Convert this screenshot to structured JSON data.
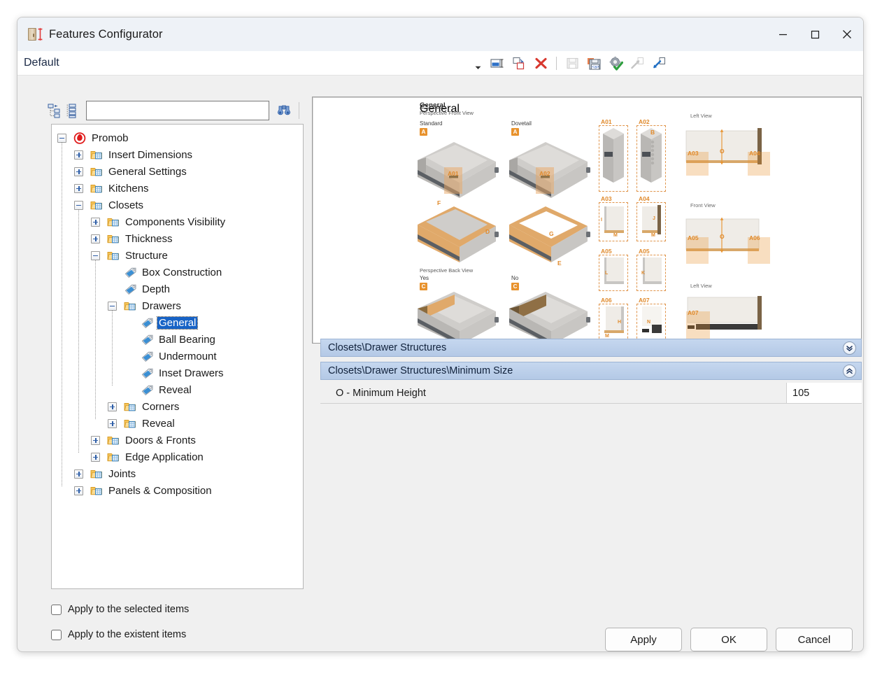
{
  "window": {
    "title": "Features Configurator",
    "icon": "cabinet-dimension-icon",
    "controls": {
      "minimize": "—",
      "maximize": "□",
      "close": "✕"
    }
  },
  "profile_bar": {
    "selected_profile": "Default",
    "dropdown_icon": "chevron-down-icon",
    "toolbar": [
      {
        "name": "rename-configuration",
        "icon": "rename-icon",
        "enabled": true
      },
      {
        "name": "duplicate-configuration",
        "icon": "copy-icon",
        "enabled": true
      },
      {
        "name": "delete-configuration",
        "icon": "delete-x-icon",
        "enabled": true
      },
      {
        "name": "separator",
        "icon": "separator",
        "enabled": true
      },
      {
        "name": "save-configuration",
        "icon": "save-disk-icon",
        "enabled": false
      },
      {
        "name": "save-as-xml",
        "icon": "save-xml-icon",
        "enabled": true
      },
      {
        "name": "settings-validate",
        "icon": "gear-check-icon",
        "enabled": true
      },
      {
        "name": "export-configuration",
        "icon": "export-arrow-icon",
        "enabled": false
      },
      {
        "name": "import-configuration",
        "icon": "import-arrow-icon",
        "enabled": true
      }
    ]
  },
  "tree_tools": {
    "collapse_all": "collapse-tree-icon",
    "expand_all": "expand-tree-icon",
    "search_value": "",
    "search_placeholder": "",
    "find_icon": "binoculars-icon"
  },
  "tree": {
    "selected": "General",
    "nodes": [
      {
        "label": "Promob",
        "depth": 0,
        "state": "expanded",
        "icon": "promob-logo-icon"
      },
      {
        "label": "Insert Dimensions",
        "depth": 1,
        "state": "collapsed",
        "icon": "folder-table-icon"
      },
      {
        "label": "General Settings",
        "depth": 1,
        "state": "collapsed",
        "icon": "folder-table-icon"
      },
      {
        "label": "Kitchens",
        "depth": 1,
        "state": "collapsed",
        "icon": "folder-table-icon"
      },
      {
        "label": "Closets",
        "depth": 1,
        "state": "expanded",
        "icon": "folder-table-icon"
      },
      {
        "label": "Components Visibility",
        "depth": 2,
        "state": "collapsed",
        "icon": "folder-table-icon"
      },
      {
        "label": "Thickness",
        "depth": 2,
        "state": "collapsed",
        "icon": "folder-table-icon"
      },
      {
        "label": "Structure",
        "depth": 2,
        "state": "expanded",
        "icon": "folder-table-icon"
      },
      {
        "label": "Box Construction",
        "depth": 3,
        "state": "leaf",
        "icon": "tag-icon"
      },
      {
        "label": "Depth",
        "depth": 3,
        "state": "leaf",
        "icon": "tag-icon"
      },
      {
        "label": "Drawers",
        "depth": 3,
        "state": "expanded",
        "icon": "folder-table-icon"
      },
      {
        "label": "General",
        "depth": 4,
        "state": "leaf",
        "icon": "tag-icon"
      },
      {
        "label": "Ball Bearing",
        "depth": 4,
        "state": "leaf",
        "icon": "tag-icon"
      },
      {
        "label": "Undermount",
        "depth": 4,
        "state": "leaf",
        "icon": "tag-icon"
      },
      {
        "label": "Inset Drawers",
        "depth": 4,
        "state": "leaf",
        "icon": "tag-icon"
      },
      {
        "label": "Reveal",
        "depth": 4,
        "state": "leaf",
        "icon": "tag-icon"
      },
      {
        "label": "Corners",
        "depth": 3,
        "state": "collapsed",
        "icon": "folder-table-icon"
      },
      {
        "label": "Reveal",
        "depth": 3,
        "state": "collapsed",
        "icon": "folder-table-icon"
      },
      {
        "label": "Doors & Fronts",
        "depth": 2,
        "state": "collapsed",
        "icon": "folder-table-icon"
      },
      {
        "label": "Edge Application",
        "depth": 2,
        "state": "collapsed",
        "icon": "folder-table-icon"
      },
      {
        "label": "Joints",
        "depth": 1,
        "state": "collapsed",
        "icon": "folder-table-icon"
      },
      {
        "label": "Panels & Composition",
        "depth": 1,
        "state": "collapsed",
        "icon": "folder-table-icon"
      }
    ]
  },
  "checkboxes": [
    {
      "label": "Apply to the selected items",
      "checked": false
    },
    {
      "label": "Apply to the existent items",
      "checked": false
    }
  ],
  "preview": {
    "title": "General",
    "subtitle": "Perspective Front View",
    "drawer_types": [
      {
        "label": "Standard",
        "code": "A",
        "tag": "A01"
      },
      {
        "label": "Dovetail",
        "code": "A",
        "tag": "A02"
      }
    ],
    "mid_tags": [
      "F",
      "D",
      "G",
      "E"
    ],
    "back_view": {
      "label": "Perspective Back View",
      "options": [
        {
          "label": "Yes",
          "code": "C"
        },
        {
          "label": "No",
          "code": "C"
        }
      ]
    },
    "detail_callouts": [
      {
        "tag": "A01",
        "note": ""
      },
      {
        "tag": "A02",
        "note": "B"
      },
      {
        "tag": "A03",
        "note": "I"
      },
      {
        "tag": "A04",
        "note": "J"
      },
      {
        "tag": "A05",
        "note": "L"
      },
      {
        "tag": "A05",
        "note": "K"
      },
      {
        "tag": "A06",
        "note": "H"
      },
      {
        "tag": "A07",
        "note": "N"
      }
    ],
    "detail_sublabels": [
      "M",
      "M",
      "M"
    ],
    "views": [
      {
        "label": "Left View",
        "dimension": "O",
        "tags": [
          "A03",
          "A04"
        ]
      },
      {
        "label": "Front View",
        "dimension": "O",
        "tags": [
          "A05",
          "A06"
        ]
      },
      {
        "label": "Left View",
        "dimension": "",
        "tags": [
          "A07"
        ]
      }
    ]
  },
  "property_groups": [
    {
      "title": "Closets\\Drawer Structures",
      "expanded": false,
      "chevron": "chevron-double-down-icon"
    },
    {
      "title": "Closets\\Drawer Structures\\Minimum Size",
      "expanded": true,
      "chevron": "chevron-double-up-icon"
    }
  ],
  "properties": [
    {
      "name": "O - Minimum Height",
      "value": "105"
    }
  ],
  "footer_buttons": [
    {
      "label": "Apply",
      "name": "apply-button"
    },
    {
      "label": "OK",
      "name": "ok-button"
    },
    {
      "label": "Cancel",
      "name": "cancel-button"
    }
  ],
  "colors": {
    "accent_blue": "#1763c6",
    "group_header": "#b4c9e6",
    "folder_orange": "#f0b43c",
    "tag_blue": "#3a8fd4",
    "marker_orange": "#e8922d",
    "window_bg": "#f0f0f0"
  }
}
